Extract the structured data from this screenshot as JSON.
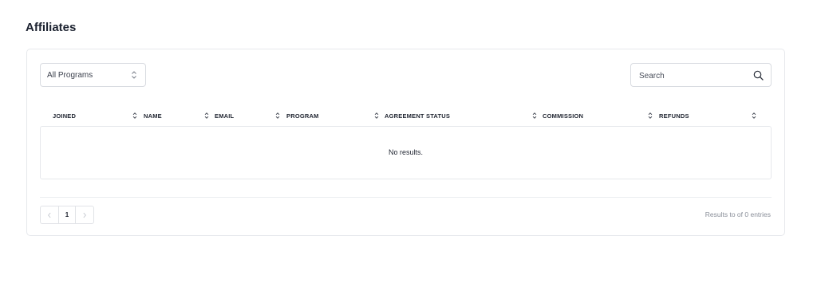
{
  "page": {
    "title": "Affiliates"
  },
  "filters": {
    "program_select": {
      "value": "All Programs",
      "icon": "chevron-updown-icon"
    },
    "search": {
      "placeholder": "Search",
      "value": "",
      "icon": "search-icon"
    }
  },
  "table": {
    "columns": [
      {
        "label": "JOINED"
      },
      {
        "label": "NAME"
      },
      {
        "label": "EMAIL"
      },
      {
        "label": "PROGRAM"
      },
      {
        "label": "AGREEMENT STATUS"
      },
      {
        "label": "COMMISSION"
      },
      {
        "label": "REFUNDS"
      }
    ],
    "rows": [],
    "empty_message": "No results."
  },
  "pagination": {
    "prev_icon": "chevron-left-icon",
    "current_page": "1",
    "next_icon": "chevron-right-icon",
    "summary": "Results to of 0 entries"
  },
  "colors": {
    "border": "#e6e8ec",
    "text": "#1f2430",
    "muted": "#8a8f99"
  }
}
